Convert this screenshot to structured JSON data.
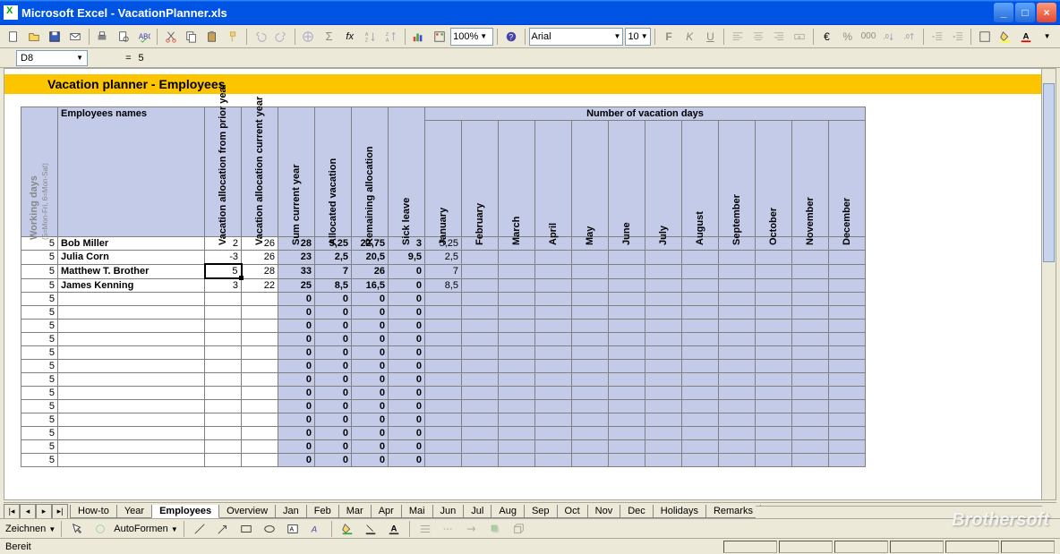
{
  "window": {
    "app": "Microsoft Excel",
    "file": "VacationPlanner.xls"
  },
  "toolbar": {
    "zoom": "100%",
    "font": "Arial",
    "size": "10"
  },
  "formula_bar": {
    "cell_ref": "D8",
    "fx_symbol": "=",
    "value": "5"
  },
  "banner": "Vacation planner - Employees",
  "headers": {
    "working_days": "Working days",
    "working_days_sub": "(5=Mon-Fri, 6=Mon-Sat)",
    "employees_names": "Employees names",
    "vac_prior": "Vacation allocation from prior year",
    "vac_current": "Vacation allocation current year",
    "sum_current": "Sum current year",
    "allocated": "Allocated vacation",
    "remaining": "Remaining allocation",
    "sick": "Sick leave",
    "num_vac_days": "Number of vacation days",
    "months": [
      "January",
      "February",
      "March",
      "April",
      "May",
      "June",
      "July",
      "August",
      "September",
      "October",
      "November",
      "December"
    ]
  },
  "rows": [
    {
      "wd": "5",
      "name": "Bob Miller",
      "prior": "2",
      "cur": "26",
      "sum": "28",
      "alloc": "5,25",
      "rem": "22,75",
      "sick": "3",
      "jan": "5,25",
      "feb": ""
    },
    {
      "wd": "5",
      "name": "Julia Corn",
      "prior": "-3",
      "cur": "26",
      "sum": "23",
      "alloc": "2,5",
      "rem": "20,5",
      "sick": "9,5",
      "jan": "2,5",
      "feb": ""
    },
    {
      "wd": "5",
      "name": "Matthew T. Brother",
      "prior": "5",
      "cur": "28",
      "sum": "33",
      "alloc": "7",
      "rem": "26",
      "sick": "0",
      "jan": "7",
      "feb": ""
    },
    {
      "wd": "5",
      "name": "James Kenning",
      "prior": "3",
      "cur": "22",
      "sum": "25",
      "alloc": "8,5",
      "rem": "16,5",
      "sick": "0",
      "jan": "8,5",
      "feb": ""
    }
  ],
  "empty_rows": 13,
  "empty_row": {
    "wd": "5",
    "sum": "0",
    "alloc": "0",
    "rem": "0",
    "sick": "0"
  },
  "sheet_tabs": [
    "How-to",
    "Year",
    "Employees",
    "Overview",
    "Jan",
    "Feb",
    "Mar",
    "Apr",
    "Mai",
    "Jun",
    "Jul",
    "Aug",
    "Sep",
    "Oct",
    "Nov",
    "Dec",
    "Holidays",
    "Remarks"
  ],
  "active_tab": "Employees",
  "draw": {
    "label": "Zeichnen",
    "autoshapes": "AutoFormen"
  },
  "status": "Bereit",
  "watermark": "Brothersoft"
}
